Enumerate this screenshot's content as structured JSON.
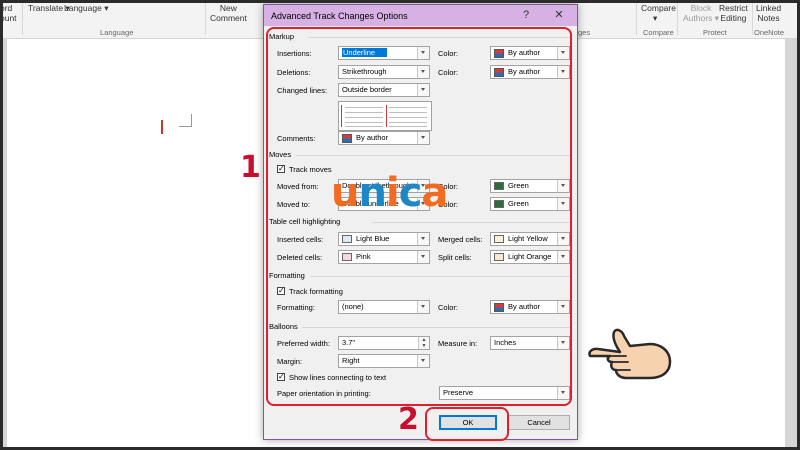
{
  "ribbon": {
    "word_count": [
      "ord",
      "ount"
    ],
    "translate": "Translate",
    "language": "Language",
    "group_language": "Language",
    "new_comment": [
      "New",
      "Comment"
    ],
    "compare": [
      "Compare",
      "Compare"
    ],
    "block_authors": [
      "Block",
      "Authors"
    ],
    "restrict_editing": [
      "Restrict",
      "Editing"
    ],
    "linked_notes": [
      "Linked",
      "Notes"
    ],
    "group_changes": "ges",
    "group_compare": "Compare",
    "group_protect": "Protect",
    "group_onenote": "OneNote"
  },
  "dialog": {
    "title": "Advanced Track Changes Options",
    "help": "?",
    "close": "✕",
    "markup": {
      "section": "Markup",
      "insertions_label": "Insertions:",
      "insertions_value": "Underline",
      "insertions_color_label": "Color:",
      "insertions_color_value": "By author",
      "deletions_label": "Deletions:",
      "deletions_value": "Strikethrough",
      "deletions_color_label": "Color:",
      "deletions_color_value": "By author",
      "changed_lines_label": "Changed lines:",
      "changed_lines_value": "Outside border",
      "comments_label": "Comments:",
      "comments_value": "By author"
    },
    "moves": {
      "section": "Moves",
      "track_moves": "Track moves",
      "track_moves_checked": true,
      "moved_from_label": "Moved from:",
      "moved_from_value": "Double strikethrough",
      "moved_from_color_label": "Color:",
      "moved_from_color_value": "Green",
      "moved_to_label": "Moved to:",
      "moved_to_value": "Double underline",
      "moved_to_color_label": "Color:",
      "moved_to_color_value": "Green"
    },
    "table_cells": {
      "section": "Table cell highlighting",
      "inserted_label": "Inserted cells:",
      "inserted_value": "Light Blue",
      "merged_label": "Merged cells:",
      "merged_value": "Light Yellow",
      "deleted_label": "Deleted cells:",
      "deleted_value": "Pink",
      "split_label": "Split cells:",
      "split_value": "Light Orange"
    },
    "formatting": {
      "section": "Formatting",
      "track_formatting": "Track formatting",
      "track_formatting_checked": true,
      "formatting_label": "Formatting:",
      "formatting_value": "(none)",
      "color_label": "Color:",
      "color_value": "By author"
    },
    "balloons": {
      "section": "Balloons",
      "preferred_width_label": "Preferred width:",
      "preferred_width_value": "3.7\"",
      "measure_in_label": "Measure in:",
      "measure_in_value": "Inches",
      "margin_label": "Margin:",
      "margin_value": "Right",
      "show_lines": "Show lines connecting to text",
      "show_lines_checked": true,
      "paper_orientation_label": "Paper orientation in printing:",
      "paper_orientation_value": "Preserve"
    },
    "ok": "OK",
    "cancel": "Cancel"
  },
  "annotations": {
    "step1": "1",
    "step2": "2"
  },
  "watermark": {
    "u": "u",
    "n": "n",
    "i": "i",
    "c": "c",
    "a": "a"
  },
  "colors": {
    "green": "#2e6b3c",
    "light_blue": "#dcebf7",
    "light_yellow": "#fbf3d8",
    "pink": "#f7d6e6",
    "light_orange": "#fde6d2",
    "annotation_red": "#e0202a",
    "titlebar": "#d7b1e3"
  }
}
